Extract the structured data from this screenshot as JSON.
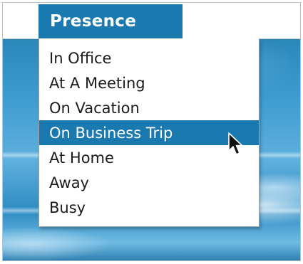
{
  "menu": {
    "title": "Presence",
    "items": [
      {
        "label": "In Office"
      },
      {
        "label": "At A Meeting"
      },
      {
        "label": "On Vacation"
      },
      {
        "label": "On Business Trip"
      },
      {
        "label": "At Home"
      },
      {
        "label": "Away"
      },
      {
        "label": "Busy"
      }
    ],
    "selected_index": 3
  },
  "colors": {
    "accent": "#1a7ab0",
    "menu_background": "#ffffff",
    "text": "#1b1b1b",
    "selected_text": "#ffffff",
    "desktop": "#3c9ad0"
  },
  "icons": {
    "cursor": "arrow-pointer-icon"
  }
}
